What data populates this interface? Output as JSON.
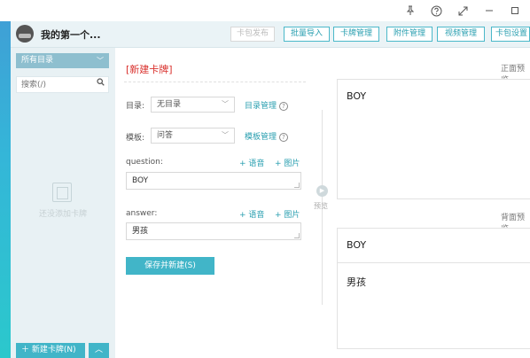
{
  "window": {
    "pin_icon": "pin-icon",
    "help_icon": "help-icon",
    "expand_icon": "expand-icon",
    "minimize_icon": "minimize-icon",
    "maximize_icon": "maximize-icon"
  },
  "header": {
    "deck_title": "我的第一个...",
    "buttons": {
      "publish": "卡包发布",
      "batch_import": "批量导入",
      "card_manage": "卡牌管理",
      "attachment_manage": "附件管理",
      "video_manage": "视频管理",
      "deck_settings": "卡包设置"
    }
  },
  "sidebar": {
    "directory": "所有目录",
    "search_placeholder": "搜索(/)",
    "empty_text": "还没添加卡牌",
    "new_card": "新建卡牌(N)"
  },
  "editor": {
    "title": "[新建卡牌]",
    "directory_label": "目录:",
    "directory_value": "无目录",
    "directory_link": "目录管理",
    "template_label": "模板:",
    "template_value": "问答",
    "template_link": "模板管理",
    "question_label": "question:",
    "question_value": "BOY",
    "answer_label": "answer:",
    "answer_value": "男孩",
    "add_audio": "+ 语音",
    "add_image": "+ 图片",
    "save_button": "保存并新建(S)"
  },
  "preview": {
    "play_label": "预览",
    "front_label": "正面预览",
    "back_label": "背面预览",
    "front_text": "BOY",
    "back_question": "BOY",
    "back_answer": "男孩"
  }
}
